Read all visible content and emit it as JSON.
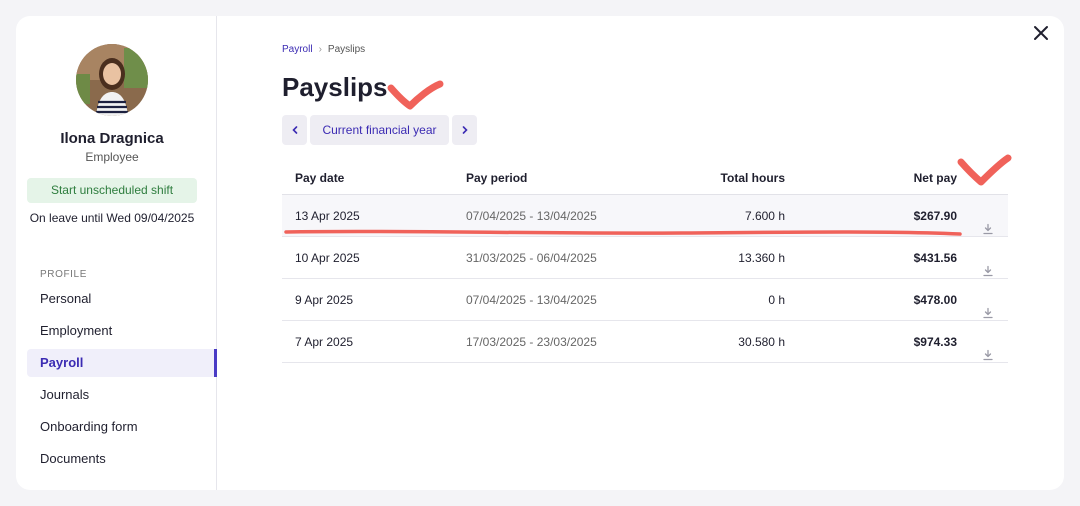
{
  "user": {
    "name": "Ilona Dragnica",
    "role": "Employee",
    "shift_button": "Start unscheduled shift",
    "leave_note": "On leave until Wed 09/04/2025"
  },
  "sidebar": {
    "section_label": "PROFILE",
    "items": [
      {
        "label": "Personal",
        "active": false
      },
      {
        "label": "Employment",
        "active": false
      },
      {
        "label": "Payroll",
        "active": true
      },
      {
        "label": "Journals",
        "active": false
      },
      {
        "label": "Onboarding form",
        "active": false
      },
      {
        "label": "Documents",
        "active": false
      }
    ]
  },
  "breadcrumb": {
    "parent": "Payroll",
    "current": "Payslips"
  },
  "page": {
    "title": "Payslips",
    "period_label": "Current financial year"
  },
  "table": {
    "headers": [
      "Pay date",
      "Pay period",
      "Total hours",
      "Net pay"
    ],
    "rows": [
      {
        "pay_date": "13 Apr 2025",
        "pay_period": "07/04/2025 - 13/04/2025",
        "total_hours": "7.600 h",
        "net_pay": "$267.90"
      },
      {
        "pay_date": "10 Apr 2025",
        "pay_period": "31/03/2025 - 06/04/2025",
        "total_hours": "13.360 h",
        "net_pay": "$431.56"
      },
      {
        "pay_date": "9 Apr 2025",
        "pay_period": "07/04/2025 - 13/04/2025",
        "total_hours": "0 h",
        "net_pay": "$478.00"
      },
      {
        "pay_date": "7 Apr 2025",
        "pay_period": "17/03/2025 - 23/03/2025",
        "total_hours": "30.580 h",
        "net_pay": "$974.33"
      }
    ]
  },
  "icons": {
    "close": "close-icon",
    "prev": "chevron-left-icon",
    "next": "chevron-right-icon",
    "download": "download-icon"
  },
  "colors": {
    "accent": "#3b2bb3",
    "success_bg": "#e5f4e8",
    "success_text": "#2e7d3e",
    "annotation": "#f0625a"
  }
}
